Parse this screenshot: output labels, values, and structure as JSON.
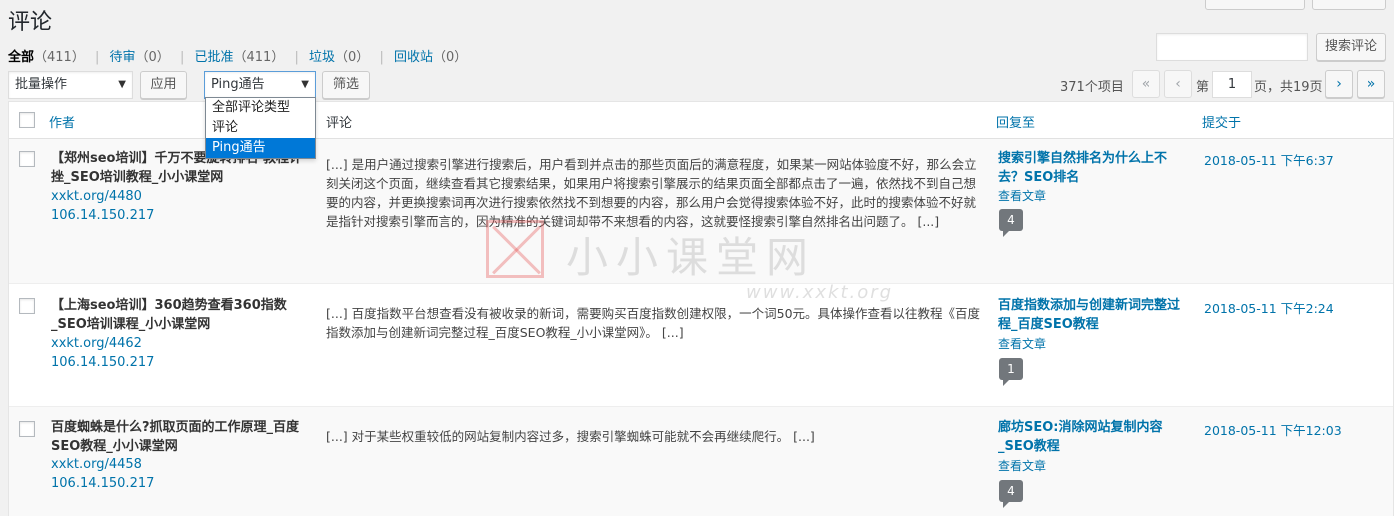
{
  "page": {
    "title": "评论"
  },
  "filters": [
    {
      "label": "全部",
      "count": "（411）",
      "current": true
    },
    {
      "label": "待审",
      "count": "（0）"
    },
    {
      "label": "已批准",
      "count": "（411）"
    },
    {
      "label": "垃圾",
      "count": "（0）"
    },
    {
      "label": "回收站",
      "count": "（0）"
    }
  ],
  "search": {
    "button": "搜索评论",
    "value": ""
  },
  "toolbar": {
    "bulk_select": "批量操作",
    "apply": "应用",
    "type_select": "Ping通告",
    "filter": "筛选"
  },
  "type_dropdown": {
    "options": [
      "全部评论类型",
      "评论",
      "Ping通告"
    ],
    "selected_index": 2
  },
  "pagination": {
    "items_count": "371个项目",
    "first": "«",
    "prev": "‹",
    "page_prefix": "第",
    "current_page": "1",
    "page_suffix": "页，共19页",
    "next": "›",
    "last": "»"
  },
  "table": {
    "headers": {
      "author": "作者",
      "comment": "评论",
      "response": "回复至",
      "submitted": "提交于"
    },
    "rows": [
      {
        "author": "【郑州seo培训】千万不要旋转排名 教程计挫_SEO培训教程_小小课堂网",
        "url": "xxkt.org/4480",
        "ip": "106.14.150.217",
        "comment": "[...] 是用户通过搜索引擎进行搜索后，用户看到并点击的那些页面后的满意程度，如果某一网站体验度不好，那么会立刻关闭这个页面，继续查看其它搜索结果，如果用户将搜索引擎展示的结果页面全部都点击了一遍，依然找不到自己想要的内容，并更换搜索词再次进行搜索依然找不到想要的内容，那么用户会觉得搜索体验不好，此时的搜索体验不好就是指针对搜索引擎而言的，因为精准的关键词却带不来想看的内容，这就要怪搜索引擎自然排名出问题了。 [...]",
        "response_title": "搜索引擎自然排名为什么上不去？SEO排名",
        "response_view": "查看文章",
        "count": "4",
        "date": "2018-05-11 下午6:37"
      },
      {
        "author": "【上海seo培训】360趋势查看360指数_SEO培训课程_小小课堂网",
        "url": "xxkt.org/4462",
        "ip": "106.14.150.217",
        "comment": "[...] 百度指数平台想查看没有被收录的新词，需要购买百度指数创建权限，一个词50元。具体操作查看以往教程《百度指数添加与创建新词完整过程_百度SEO教程_小小课堂网》。 [...]",
        "response_title": "百度指数添加与创建新词完整过程_百度SEO教程",
        "response_view": "查看文章",
        "count": "1",
        "date": "2018-05-11 下午2:24"
      },
      {
        "author": "百度蜘蛛是什么?抓取页面的工作原理_百度SEO教程_小小课堂网",
        "url": "xxkt.org/4458",
        "ip": "106.14.150.217",
        "comment": "[...] 对于某些权重较低的网站复制内容过多，搜索引擎蜘蛛可能就不会再继续爬行。 [...]",
        "response_title": "廊坊SEO:消除网站复制内容_SEO教程",
        "response_view": "查看文章",
        "count": "4",
        "date": "2018-05-11 下午12:03"
      }
    ]
  },
  "watermark": {
    "text": "小小课堂网",
    "url": "www.xxkt.org"
  }
}
